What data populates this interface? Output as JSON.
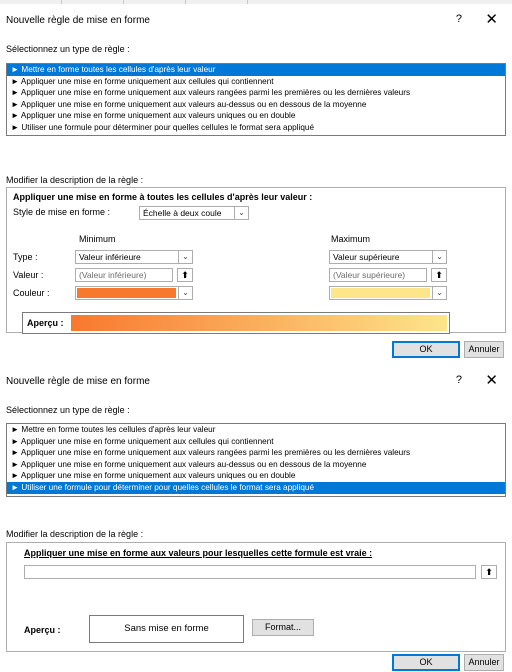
{
  "dialog1": {
    "title": "Nouvelle règle de mise en forme",
    "help": "?",
    "close": "✕",
    "select_rule_label": "Sélectionnez un type de règle :",
    "rule_types": [
      "► Mettre en forme toutes les cellules d'après leur valeur",
      "► Appliquer une mise en forme uniquement aux cellules qui contiennent",
      "► Appliquer une mise en forme uniquement aux valeurs rangées parmi les premières ou les dernières valeurs",
      "► Appliquer une mise en forme uniquement aux valeurs au-dessus ou en dessous de la moyenne",
      "► Appliquer une mise en forme uniquement aux valeurs uniques ou en double",
      "► Utiliser une formule pour déterminer pour quelles cellules le format sera appliqué"
    ],
    "selected_rule_index": 0,
    "edit_desc_label": "Modifier la description de la règle :",
    "desc_heading": "Appliquer une mise en forme à toutes les cellules d'après leur valeur :",
    "format_style_label": "Style de mise en forme :",
    "format_style_value": "Échelle à deux coule",
    "minimum_header": "Minimum",
    "maximum_header": "Maximum",
    "type_label": "Type :",
    "value_label": "Valeur :",
    "color_label": "Couleur :",
    "min_type": "Valeur inférieure",
    "max_type": "Valeur supérieure",
    "min_value_placeholder": "(Valeur inférieure)",
    "max_value_placeholder": "(Valeur supérieure)",
    "min_color": "#f8782e",
    "max_color": "#fde58a",
    "preview_label": "Aperçu :",
    "ok": "OK",
    "cancel": "Annuler"
  },
  "dialog2": {
    "title": "Nouvelle règle de mise en forme",
    "help": "?",
    "close": "✕",
    "select_rule_label": "Sélectionnez un type de règle :",
    "rule_types": [
      "► Mettre en forme toutes les cellules d'après leur valeur",
      "► Appliquer une mise en forme uniquement aux cellules qui contiennent",
      "► Appliquer une mise en forme uniquement aux valeurs rangées parmi les premières ou les dernières valeurs",
      "► Appliquer une mise en forme uniquement aux valeurs au-dessus ou en dessous de la moyenne",
      "► Appliquer une mise en forme uniquement aux valeurs uniques ou en double",
      "► Utiliser une formule pour déterminer pour quelles cellules le format sera appliqué"
    ],
    "selected_rule_index": 5,
    "edit_desc_label": "Modifier la description de la règle :",
    "formula_heading": "Appliquer une mise en forme aux valeurs pour lesquelles cette formule est vraie :",
    "formula_value": "",
    "preview_label": "Aperçu :",
    "preview_text": "Sans mise en forme",
    "format_button": "Format...",
    "ok": "OK",
    "cancel": "Annuler"
  },
  "colors": {
    "selection": "#0078d7",
    "gradient_start": "#f8782e",
    "gradient_end": "#fde58a"
  }
}
